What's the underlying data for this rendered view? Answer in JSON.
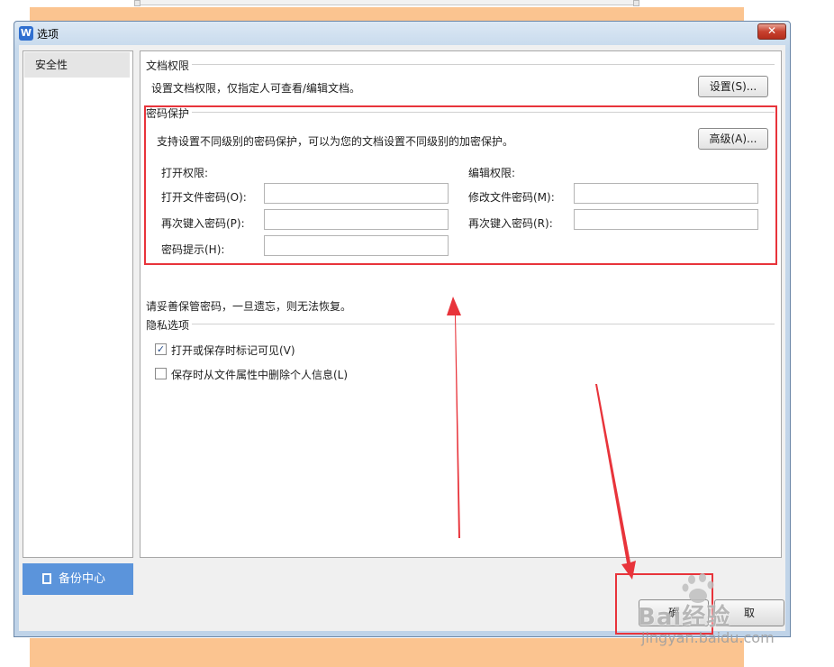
{
  "window": {
    "title": "选项",
    "app_icon": "W"
  },
  "sidebar": {
    "items": [
      {
        "label": "安全性"
      }
    ],
    "backup_button": "备份中心"
  },
  "doc_permission": {
    "title": "文档权限",
    "description": "设置文档权限，仅指定人可查看/编辑文档。",
    "button": "设置(S)..."
  },
  "password_protection": {
    "title": "密码保护",
    "description": "支持设置不同级别的密码保护，可以为您的文档设置不同级别的加密保护。",
    "advanced_button": "高级(A)...",
    "open_permission": {
      "heading": "打开权限:",
      "password_label": "打开文件密码(O):",
      "password_value": "",
      "confirm_label": "再次键入密码(P):",
      "confirm_value": "",
      "hint_label": "密码提示(H):",
      "hint_value": ""
    },
    "edit_permission": {
      "heading": "编辑权限:",
      "password_label": "修改文件密码(M):",
      "password_value": "",
      "confirm_label": "再次键入密码(R):",
      "confirm_value": ""
    }
  },
  "warning": "请妥善保管密码，一旦遗忘，则无法恢复。",
  "privacy": {
    "title": "隐私选项",
    "options": [
      {
        "label": "打开或保存时标记可见(V)",
        "checked": true
      },
      {
        "label": "保存时从文件属性中删除个人信息(L)",
        "checked": false
      }
    ]
  },
  "footer": {
    "ok_fragment": "确",
    "cancel_fragment": "取"
  },
  "watermark": {
    "text": "Bai经验",
    "url": "jingyan.baidu.com"
  },
  "colors": {
    "annotation_red": "#e8343b",
    "accent_blue": "#5b94db",
    "background_orange": "#fbc490"
  }
}
